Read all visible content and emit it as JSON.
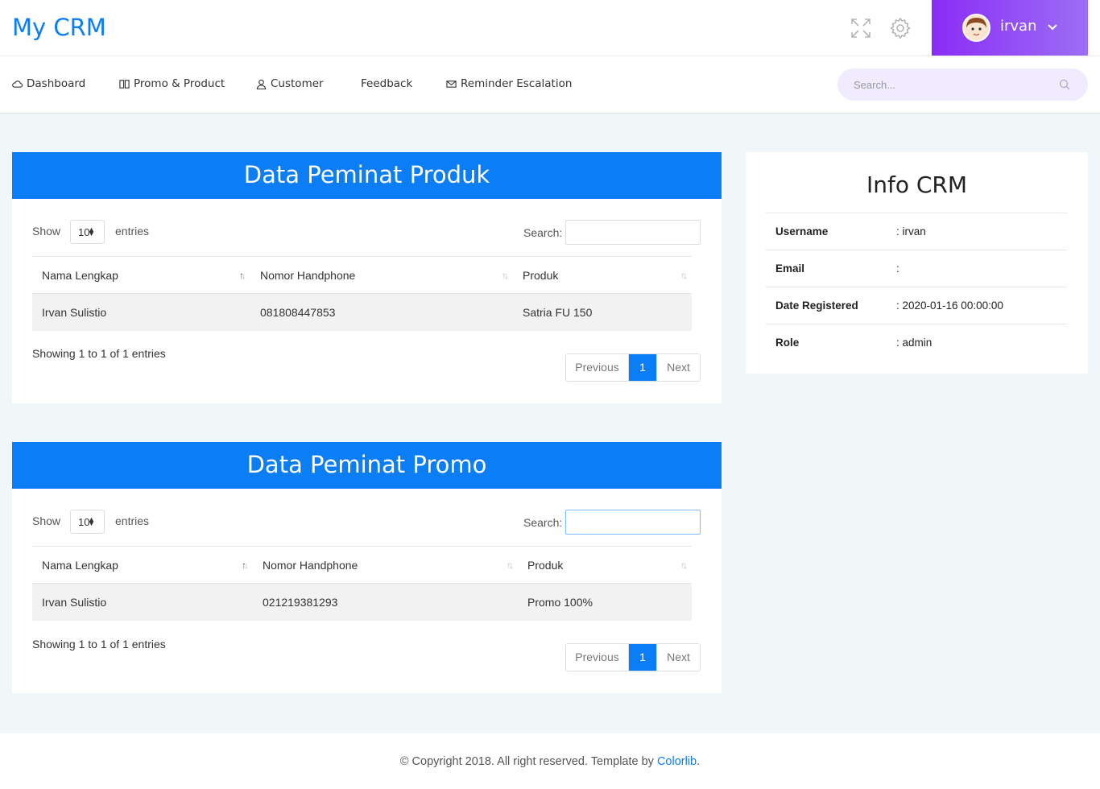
{
  "header": {
    "logo": "My CRM",
    "user_name": "irvan",
    "icons": [
      "fullscreen-icon",
      "gear-icon",
      "chevron-down-icon"
    ]
  },
  "nav": {
    "items": [
      {
        "label": "Dashboard",
        "icon": "cloud-icon"
      },
      {
        "label": "Promo & Product",
        "icon": "book-icon"
      },
      {
        "label": "Customer",
        "icon": "user-icon"
      },
      {
        "label": "Feedback",
        "icon": ""
      },
      {
        "label": "Reminder Escalation",
        "icon": "mail-icon"
      }
    ],
    "search_placeholder": "Search..."
  },
  "produk_panel": {
    "title": "Data Peminat Produk",
    "show_label": "Show",
    "entries_value": "10",
    "entries_label": "entries",
    "search_label": "Search:",
    "columns": [
      "Nama Lengkap",
      "Nomor Handphone",
      "Produk"
    ],
    "rows": [
      [
        "Irvan Sulistio",
        "081808447853",
        "Satria FU 150"
      ]
    ],
    "info": "Showing 1 to 1 of 1 entries",
    "pager": {
      "previous": "Previous",
      "page": "1",
      "next": "Next"
    }
  },
  "promo_panel": {
    "title": "Data Peminat Promo",
    "show_label": "Show",
    "entries_value": "10",
    "entries_label": "entries",
    "search_label": "Search:",
    "columns": [
      "Nama Lengkap",
      "Nomor Handphone",
      "Produk"
    ],
    "rows": [
      [
        "Irvan Sulistio",
        "021219381293",
        "Promo 100%"
      ]
    ],
    "info": "Showing 1 to 1 of 1 entries",
    "pager": {
      "previous": "Previous",
      "page": "1",
      "next": "Next"
    }
  },
  "info_crm": {
    "title": "Info CRM",
    "rows": [
      {
        "key": "Username",
        "value": ": irvan"
      },
      {
        "key": "Email",
        "value": ":"
      },
      {
        "key": "Date Registered",
        "value": ": 2020-01-16 00:00:00"
      },
      {
        "key": "Role",
        "value": ": admin"
      }
    ]
  },
  "footer": {
    "text": "© Copyright 2018. All right reserved. Template by ",
    "link": "Colorlib",
    "end": "."
  },
  "colors": {
    "primary": "#0b7df5",
    "user_gradient_start": "#8a2cf5",
    "user_gradient_end": "#9c6ef5",
    "search_bg": "#f0ebff"
  }
}
